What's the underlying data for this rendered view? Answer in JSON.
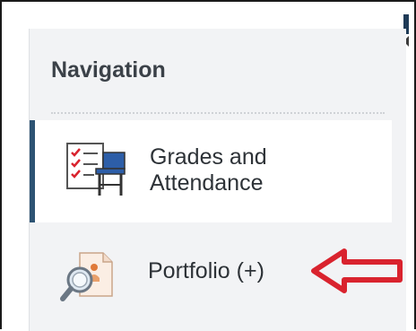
{
  "navigation": {
    "title": "Navigation",
    "items": [
      {
        "label_line1": "Grades and",
        "label_line2": "Attendance",
        "icon": "grades-attendance-icon",
        "active": true
      },
      {
        "label": "Portfolio (+)",
        "icon": "portfolio-icon",
        "active": false
      }
    ]
  },
  "annotation": {
    "icon": "red-arrow-icon",
    "color": "#d9232e"
  },
  "colors": {
    "active_indicator": "#2d5373",
    "panel_background": "#f2f3f5",
    "text": "#2d3237"
  }
}
